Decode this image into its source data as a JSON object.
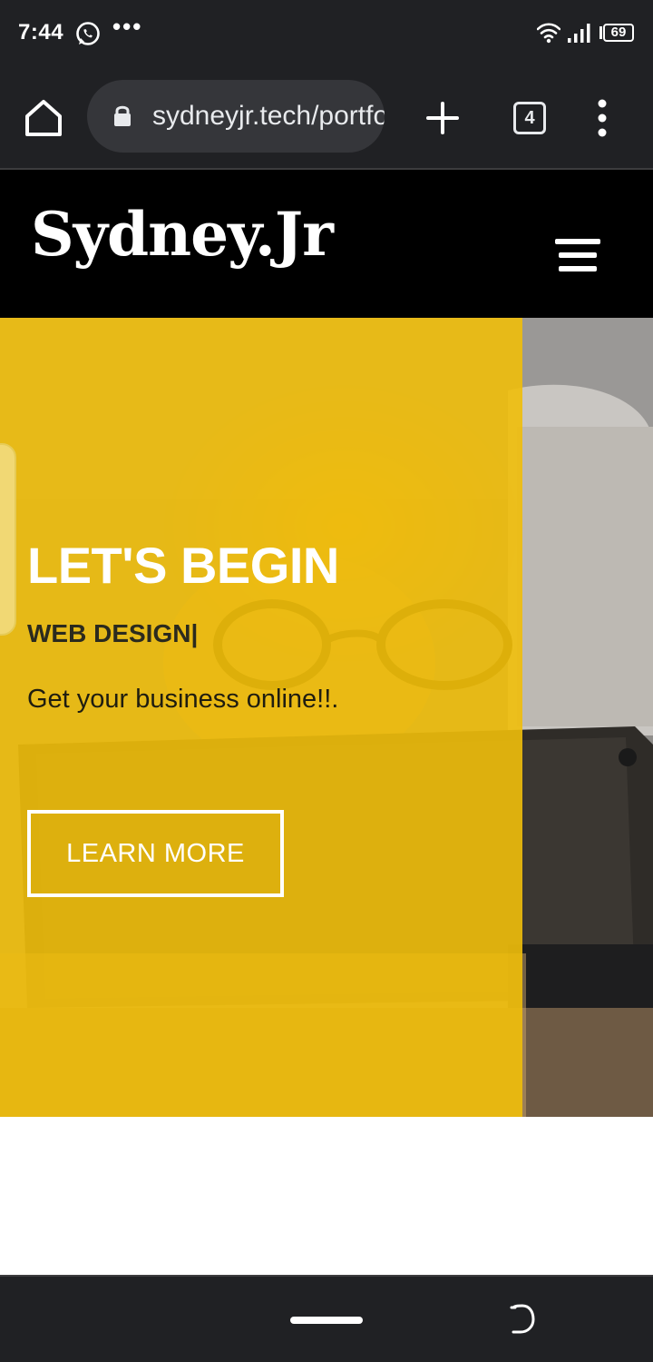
{
  "status_bar": {
    "time": "7:44",
    "notification_dots": "•••",
    "battery_level": "69",
    "icons": [
      "whatsapp-icon",
      "wifi-icon",
      "signal-icon",
      "battery-icon"
    ]
  },
  "browser": {
    "url": "sydneyjr.tech/portfolio",
    "tab_count": "4",
    "icons": [
      "home-icon",
      "lock-icon",
      "plus-icon",
      "overflow-menu-icon"
    ]
  },
  "site": {
    "logo": "Sydney.Jr",
    "menu_icon": "hamburger-icon"
  },
  "hero": {
    "title": "LET'S BEGIN",
    "subtitle": "WEB DESIGN|",
    "tagline": "Get your business online!!.",
    "cta_label": "LEARN MORE",
    "overlay_color": "#f0be0a"
  },
  "colors": {
    "system_bar": "#202124",
    "header_bg": "#000000",
    "accent_yellow": "#f0be0a"
  }
}
